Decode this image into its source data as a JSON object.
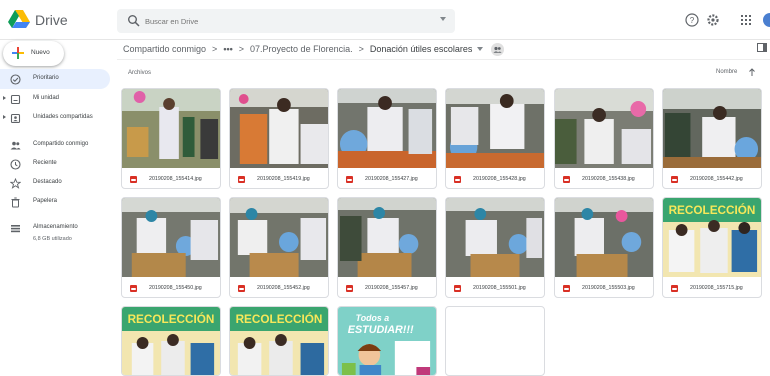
{
  "app": {
    "name": "Drive"
  },
  "search": {
    "placeholder": "Buscar en Drive"
  },
  "header_icons": [
    "help-icon",
    "settings-icon",
    "apps-grid-icon",
    "account-avatar"
  ],
  "new_button": {
    "label": "Nuevo"
  },
  "breadcrumb": {
    "items": [
      "Compartido conmigo",
      "07.Proyecto de Florencia.",
      "Donación útiles escolares"
    ],
    "more": "•••"
  },
  "sidebar": {
    "items": [
      {
        "label": "Prioritario",
        "icon": "priority-check-icon",
        "active": true,
        "expandable": false
      },
      {
        "label": "Mi unidad",
        "icon": "my-drive-icon",
        "active": false,
        "expandable": true
      },
      {
        "label": "Unidades compartidas",
        "icon": "shared-drives-icon",
        "active": false,
        "expandable": true
      },
      {
        "label": "Compartido conmigo",
        "icon": "people-icon",
        "active": false,
        "expandable": false
      },
      {
        "label": "Reciente",
        "icon": "clock-icon",
        "active": false,
        "expandable": false
      },
      {
        "label": "Destacado",
        "icon": "star-icon",
        "active": false,
        "expandable": false
      },
      {
        "label": "Papelera",
        "icon": "trash-icon",
        "active": false,
        "expandable": false
      },
      {
        "label": "Almacenamiento",
        "icon": "storage-icon",
        "active": false,
        "expandable": false
      }
    ],
    "storage_used": "6,8 GB utilizado"
  },
  "files": {
    "heading": "Archivos",
    "sort_label": "Nombre",
    "items": [
      {
        "name": "20190208_155414.jpg"
      },
      {
        "name": "20190208_155419.jpg"
      },
      {
        "name": "20190208_155427.jpg"
      },
      {
        "name": "20190208_155428.jpg"
      },
      {
        "name": "20190208_155438.jpg"
      },
      {
        "name": "20190208_155442.jpg"
      },
      {
        "name": "20190208_155450.jpg"
      },
      {
        "name": "20190208_155452.jpg"
      },
      {
        "name": "20190208_155457.jpg"
      },
      {
        "name": "20190208_155501.jpg"
      },
      {
        "name": "20190208_155503.jpg"
      },
      {
        "name": "20190208_155715.jpg"
      },
      {
        "name": ""
      },
      {
        "name": ""
      },
      {
        "name": ""
      },
      {
        "name": ""
      }
    ]
  },
  "poster": {
    "line1": "Todos a",
    "line2": "ESTUDIAR!!!",
    "banner": "RECOLECCIÓN"
  },
  "colors": {
    "accent": "#1a73e8",
    "active_nav_bg": "#e8f0fe",
    "image_icon": "#d93025",
    "poster_bg": "#7fd1c8"
  }
}
